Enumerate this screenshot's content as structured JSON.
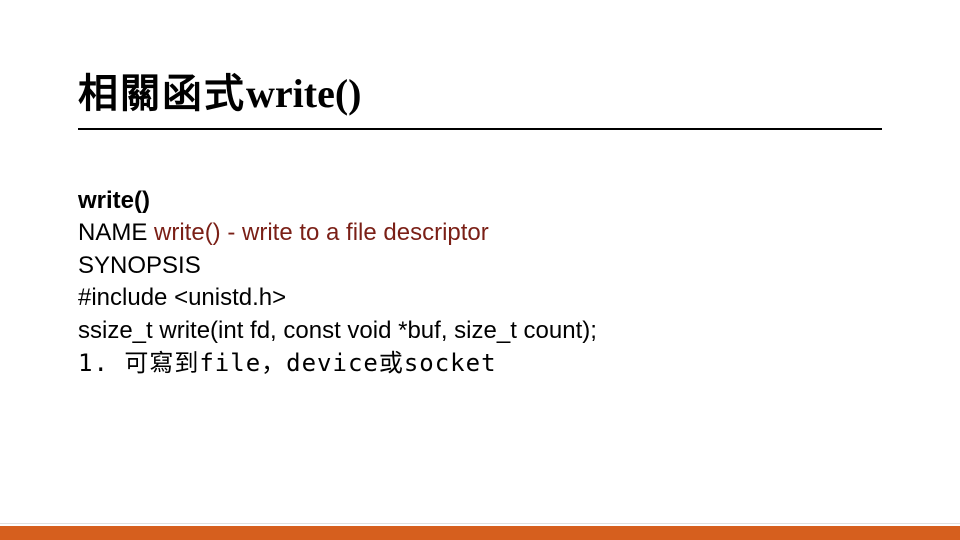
{
  "title": {
    "cjk": "相關函式",
    "latin": "write()"
  },
  "content": {
    "subtitle": "write()",
    "name_prefix": "NAME ",
    "name_func": "write()",
    "name_desc": " - write to a file descriptor",
    "synopsis": "SYNOPSIS",
    "include": "#include <unistd.h>",
    "signature": "ssize_t write(int fd, const void *buf, size_t count);",
    "note": "1. 可寫到file，device或socket"
  }
}
